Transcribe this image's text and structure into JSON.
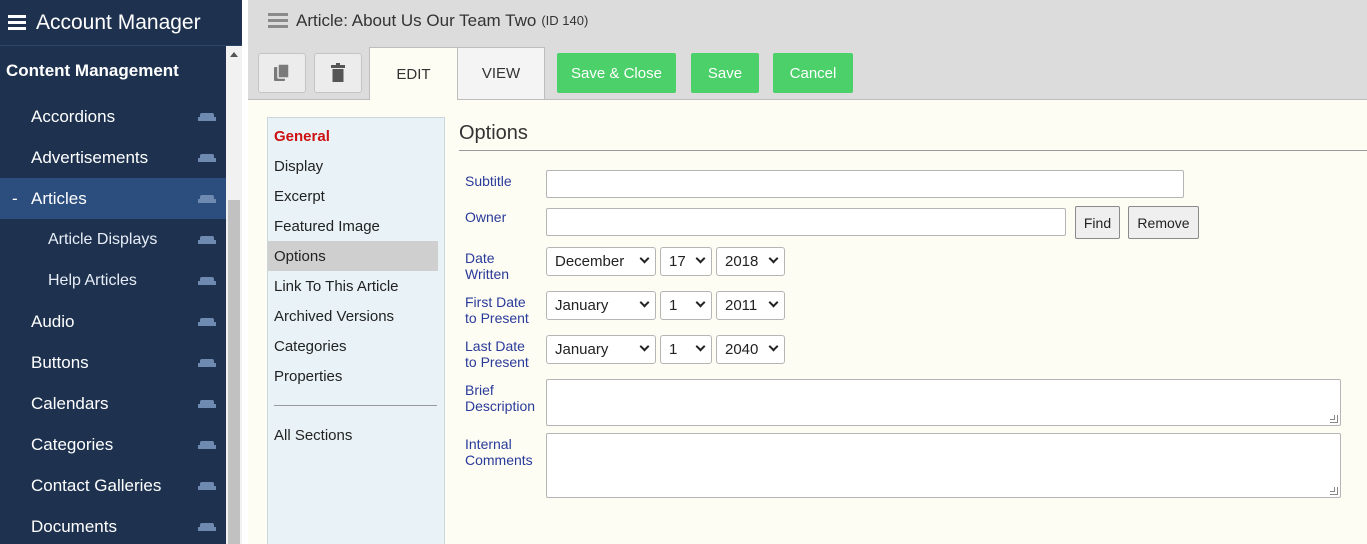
{
  "sidebar": {
    "brand": "Account Manager",
    "section_title": "Content Management",
    "items": [
      {
        "label": "Accordions"
      },
      {
        "label": "Advertisements"
      },
      {
        "label": "Articles",
        "prefix": "-"
      },
      {
        "label": "Article Displays"
      },
      {
        "label": "Help Articles"
      },
      {
        "label": "Audio"
      },
      {
        "label": "Buttons"
      },
      {
        "label": "Calendars"
      },
      {
        "label": "Categories"
      },
      {
        "label": "Contact Galleries"
      },
      {
        "label": "Documents"
      }
    ]
  },
  "header": {
    "title": "Article: About Us Our Team Two",
    "id_text": "(ID 140)"
  },
  "toolbar": {
    "tab_edit": "EDIT",
    "tab_view": "VIEW",
    "save_close": "Save & Close",
    "save": "Save",
    "cancel": "Cancel"
  },
  "section_nav": {
    "items": [
      "General",
      "Display",
      "Excerpt",
      "Featured Image",
      "Options",
      "Link To This Article",
      "Archived Versions",
      "Categories",
      "Properties"
    ],
    "all_sections": "All Sections"
  },
  "form": {
    "title": "Options",
    "subtitle_label": "Subtitle",
    "subtitle_value": "",
    "owner_label": "Owner",
    "owner_value": "",
    "find": "Find",
    "remove": "Remove",
    "date_written_label": [
      "Date",
      "Written"
    ],
    "date_written": {
      "month": "December",
      "day": "17",
      "year": "2018"
    },
    "first_date_label": [
      "First Date",
      "to Present"
    ],
    "first_date": {
      "month": "January",
      "day": "1",
      "year": "2011"
    },
    "last_date_label": [
      "Last Date",
      "to Present"
    ],
    "last_date": {
      "month": "January",
      "day": "1",
      "year": "2040"
    },
    "brief_label": [
      "Brief",
      "Description"
    ],
    "internal_label": [
      "Internal",
      "Comments"
    ]
  },
  "colors": {
    "sidebar_bg": "#1e3250",
    "active_item": "#2c4e7e",
    "green_button": "#4cd06a",
    "current_section": "#cc1111",
    "label_blue": "#2a3a9a"
  }
}
